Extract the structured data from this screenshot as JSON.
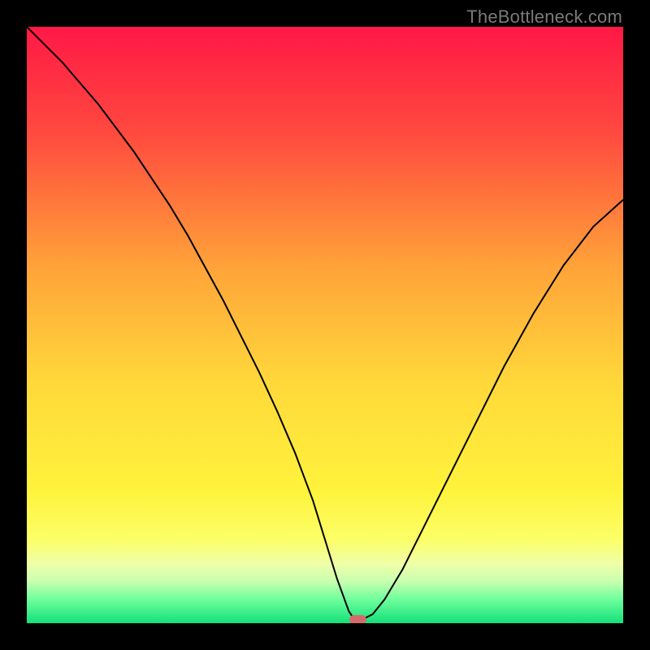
{
  "attribution": "TheBottleneck.com",
  "chart_data": {
    "type": "line",
    "title": "",
    "xlabel": "",
    "ylabel": "",
    "xlim": [
      0,
      100
    ],
    "ylim": [
      0,
      100
    ],
    "series": [
      {
        "name": "bottleneck-curve",
        "x": [
          0,
          3,
          6,
          9,
          12,
          15,
          18,
          21,
          24,
          27,
          30,
          33,
          36,
          39,
          42,
          45,
          48,
          50,
          52,
          54,
          55,
          56,
          58,
          60,
          63,
          66,
          70,
          75,
          80,
          85,
          90,
          95,
          100
        ],
        "y": [
          100,
          97,
          94,
          90.5,
          87,
          83,
          79,
          74.5,
          70,
          65,
          59.5,
          54,
          48,
          42,
          35.5,
          28.5,
          20.5,
          14,
          7.5,
          2,
          0.5,
          0.5,
          1.5,
          4,
          9,
          15,
          23,
          33,
          43,
          52,
          60,
          66.5,
          71
        ]
      }
    ],
    "gradient_stops": [
      {
        "offset": 0,
        "color": "#ff1846"
      },
      {
        "offset": 18,
        "color": "#ff4a3f"
      },
      {
        "offset": 40,
        "color": "#ffa239"
      },
      {
        "offset": 60,
        "color": "#ffd93a"
      },
      {
        "offset": 78,
        "color": "#fff33c"
      },
      {
        "offset": 86,
        "color": "#fcff68"
      },
      {
        "offset": 90,
        "color": "#f0ffa8"
      },
      {
        "offset": 93,
        "color": "#c8ffb0"
      },
      {
        "offset": 96,
        "color": "#6fff9c"
      },
      {
        "offset": 100,
        "color": "#13e07a"
      }
    ],
    "marker": {
      "x": 55.5,
      "y": 0.6,
      "w": 2.8,
      "h": 1.6
    }
  }
}
